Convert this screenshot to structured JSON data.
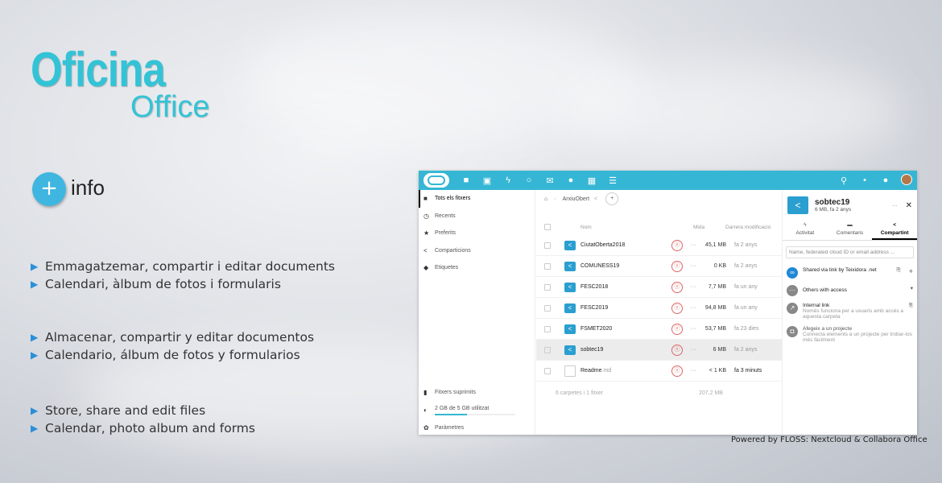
{
  "title": {
    "main": "Oficina",
    "sub": "Office"
  },
  "info_label": "info",
  "plus_symbol": "+",
  "bullets_ca": [
    "Emmagatzemar, compartir i editar documents",
    "Calendari, àlbum de fotos i formularis"
  ],
  "bullets_es": [
    "Almacenar, compartir y editar documentos",
    "Calendario, álbum de fotos y formularios"
  ],
  "bullets_en": [
    "Store, share and edit files",
    "Calendar, photo album and forms"
  ],
  "powered_by": "Powered by FLOSS: Nextcloud & Collabora Office",
  "sidebar": {
    "items": [
      "Tots els fitxers",
      "Recents",
      "Preferits",
      "Comparticions",
      "Etiquetes"
    ],
    "deleted": "Fitxers suprimits",
    "quota": "2 GB de 5 GB utilitzat",
    "settings": "Paràmetres"
  },
  "breadcrumb": "ArxiuObert",
  "table": {
    "col_name": "Nom",
    "col_size": "Mida",
    "col_date": "Darrera modificació",
    "rows": [
      {
        "name": "CiutatOberta2018",
        "ext": "",
        "size": "45,1 MB",
        "date": "fa 2 anys"
      },
      {
        "name": "COMUNESS19",
        "ext": "",
        "size": "0 KB",
        "date": "fa 2 anys"
      },
      {
        "name": "FESC2018",
        "ext": "",
        "size": "7,7 MB",
        "date": "fa un any"
      },
      {
        "name": "FESC2019",
        "ext": "",
        "size": "94,8 MB",
        "date": "fa un any"
      },
      {
        "name": "FSMET2020",
        "ext": "",
        "size": "53,7 MB",
        "date": "fa 23 dies"
      },
      {
        "name": "sobtec19",
        "ext": "",
        "size": "6 MB",
        "date": "fa 2 anys"
      },
      {
        "name": "Readme",
        "ext": ".md",
        "size": "< 1 KB",
        "date": "fa 3 minuts"
      }
    ],
    "summary": "6 carpetes i 1 fitxer",
    "summary_size": "207,2 MB"
  },
  "panel": {
    "name": "sobtec19",
    "meta": "6 MB, fa 2 anys",
    "tabs": [
      "Activitat",
      "Comentaris",
      "Compartint"
    ],
    "input_placeholder": "Name, federated cloud ID or email address ...",
    "shared_link": "Shared via link by Teixidora .net",
    "others": "Others with access",
    "internal_title": "Internal link",
    "internal_desc": "Només funciona per a usuaris amb accés a aquesta carpeta",
    "project_title": "Afegeix a un projecte",
    "project_desc": "Connecta elements a un projecte per trobar-los més fàcilment"
  },
  "colors": {
    "accent": "#33c3d6",
    "topbar": "#35b6d4"
  }
}
